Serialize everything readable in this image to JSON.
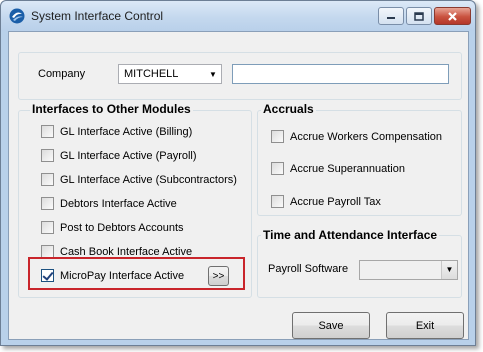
{
  "window": {
    "title": "System Interface Control",
    "controls": {
      "minimize": "–",
      "maximize": "□",
      "close": "✕"
    }
  },
  "company": {
    "label": "Company",
    "selected": "MITCHELL",
    "name_value": ""
  },
  "interfaces": {
    "title": "Interfaces to Other Modules",
    "items": [
      {
        "label": "GL Interface Active (Billing)",
        "checked": false
      },
      {
        "label": "GL Interface Active (Payroll)",
        "checked": false
      },
      {
        "label": "GL Interface Active (Subcontractors)",
        "checked": false
      },
      {
        "label": "Debtors Interface Active",
        "checked": false
      },
      {
        "label": "Post to Debtors Accounts",
        "checked": false
      },
      {
        "label": "Cash Book Interface Active",
        "checked": false
      },
      {
        "label": "MicroPay Interface Active",
        "checked": true
      }
    ],
    "more_button": ">>"
  },
  "accruals": {
    "title": "Accruals",
    "items": [
      {
        "label": "Accrue Workers Compensation",
        "checked": false
      },
      {
        "label": "Accrue Superannuation",
        "checked": false
      },
      {
        "label": "Accrue Payroll Tax",
        "checked": false
      }
    ]
  },
  "time_attendance": {
    "title": "Time and Attendance Interface",
    "payroll_label": "Payroll Software",
    "payroll_value": ""
  },
  "buttons": {
    "save": "Save",
    "exit": "Exit"
  },
  "colors": {
    "highlight": "#c9252b",
    "titlebar": "#c4d8ee",
    "close": "#c9523f"
  }
}
